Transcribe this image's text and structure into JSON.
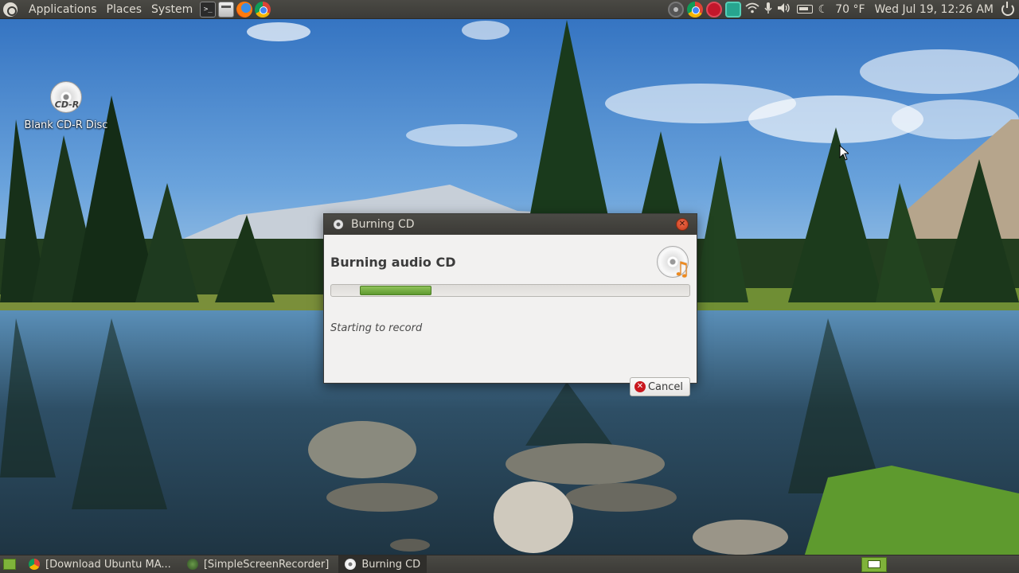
{
  "top_panel": {
    "menus": [
      "Applications",
      "Places",
      "System"
    ],
    "weather": "70 °F",
    "clock": "Wed Jul 19, 12:26 AM"
  },
  "desktop": {
    "icon_disc_text": "CD-R",
    "icon_label": "Blank CD-R Disc"
  },
  "dialog": {
    "title": "Burning CD",
    "heading": "Burning audio CD",
    "progress": {
      "start_fraction": 0.08,
      "end_fraction": 0.28
    },
    "status": "Starting to record",
    "cancel_label": "Cancel",
    "fill_color": "#6ea83a"
  },
  "taskbar": {
    "tasks": [
      {
        "label": "[Download Ubuntu MA...",
        "active": false
      },
      {
        "label": "[SimpleScreenRecorder]",
        "active": false
      },
      {
        "label": "Burning CD",
        "active": true
      }
    ]
  },
  "colors": {
    "panel": "#3c3b37",
    "panel_text": "#dfdbd2",
    "dialog_bg": "#f2f1f0",
    "close_button": "#e0552f",
    "cancel_icon": "#c9171e"
  }
}
